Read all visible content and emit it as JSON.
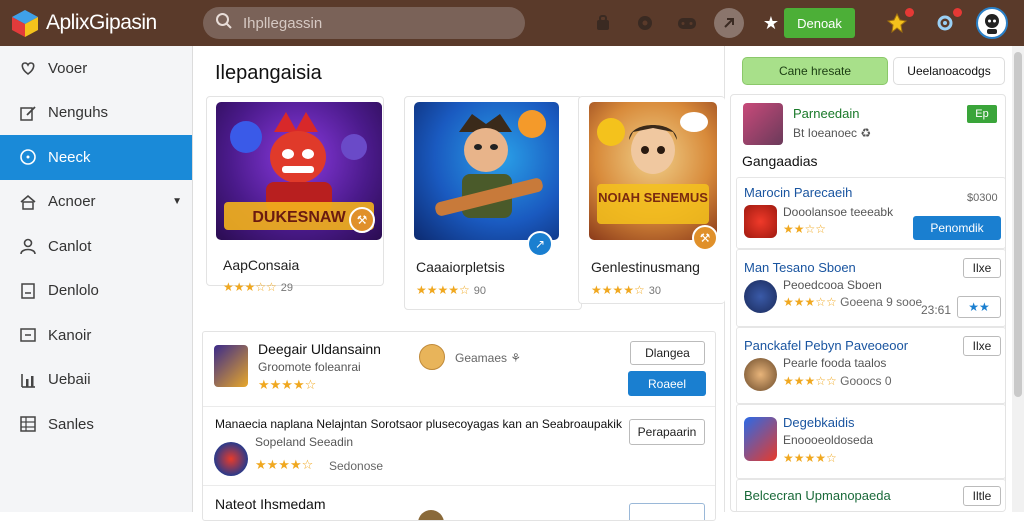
{
  "app": {
    "title": "AplixGipasin"
  },
  "search": {
    "placeholder": "Ihpllegassin"
  },
  "topbar": {
    "cta_label": "Denoak",
    "accent": "#4caf37",
    "bar_color": "#5a3a2a"
  },
  "sidebar": {
    "items": [
      {
        "label": "Vooer",
        "icon": "heart-icon"
      },
      {
        "label": "Nenguhs",
        "icon": "edit-icon"
      },
      {
        "label": "Neeck",
        "icon": "info-icon",
        "active": true
      },
      {
        "label": "Acnoer",
        "icon": "home-icon",
        "has_caret": true
      },
      {
        "label": "Canlot",
        "icon": "user-icon"
      },
      {
        "label": "Denlolo",
        "icon": "document-icon"
      },
      {
        "label": "Kanoir",
        "icon": "box-icon"
      },
      {
        "label": "Uebaii",
        "icon": "chart-icon"
      },
      {
        "label": "Sanles",
        "icon": "grid-icon"
      }
    ]
  },
  "main": {
    "title": "Ilepangaisia",
    "cards": [
      {
        "name": "AapConsaia",
        "stars": "★★★☆☆",
        "score": "29",
        "art_text": "DUKESNAW"
      },
      {
        "name": "Caaaiorpletsis",
        "stars": "★★★★☆",
        "score": "90",
        "art_text": ""
      },
      {
        "name": "Genlestinusmang",
        "stars": "★★★★☆",
        "score": "30",
        "art_text": "NOIAH SENEMUS"
      }
    ],
    "list": [
      {
        "title": "Deegair Uldansainn",
        "sub": "Groomote foleanrai",
        "stars": "★★★★☆",
        "meta": "Geamaes ⚘",
        "btn1": "Dlangea",
        "btn2": "Roaeel"
      },
      {
        "title": "Manaecia naplana Nelajntan Sorotsaor plusecoyagas kan an Seabroaupakik",
        "sub": "Sopeland Seeadin",
        "stars": "★★★★☆",
        "meta": "Sedonose",
        "btn1": "Perapaarin"
      },
      {
        "title": "Nateot Ihsmedam",
        "sub": "",
        "stars": "",
        "meta": "",
        "btn1": ""
      }
    ]
  },
  "rpanel": {
    "tab_active": "Cane hresate",
    "tab_other": "Ueelanoacodgs",
    "head_name": "Parneedain",
    "head_sub": "Bt Ioeanoec ♻",
    "head_btn": "Ep",
    "section_title": "Gangaadias",
    "items": [
      {
        "title": "Marocin Parecaeih",
        "sub": "Dooolansoe teeeabk",
        "stars": "★★☆☆",
        "meta": "$0300",
        "btn": "Penomdik"
      },
      {
        "title": "Man Tesano Sboen",
        "sub": "Peoedcooa Sboen",
        "stars": "★★★☆☆",
        "meta": "Goeena 9 sooe",
        "btn": "Ilxe",
        "time": "23:61"
      },
      {
        "title": "Panckafel Pebyn Paveoeoor",
        "sub": "Pearle fooda taalos",
        "stars": "★★★☆☆",
        "meta": "Gooocs 0",
        "btn": "Ilxe"
      },
      {
        "title": "Degebkaidis",
        "sub": "Enoooeoldoseda",
        "stars": "★★★★☆",
        "meta": ""
      },
      {
        "title": "Belcecran Upmanopaeda",
        "sub": "",
        "stars": "",
        "meta": "",
        "btn": "Iltle"
      }
    ]
  }
}
